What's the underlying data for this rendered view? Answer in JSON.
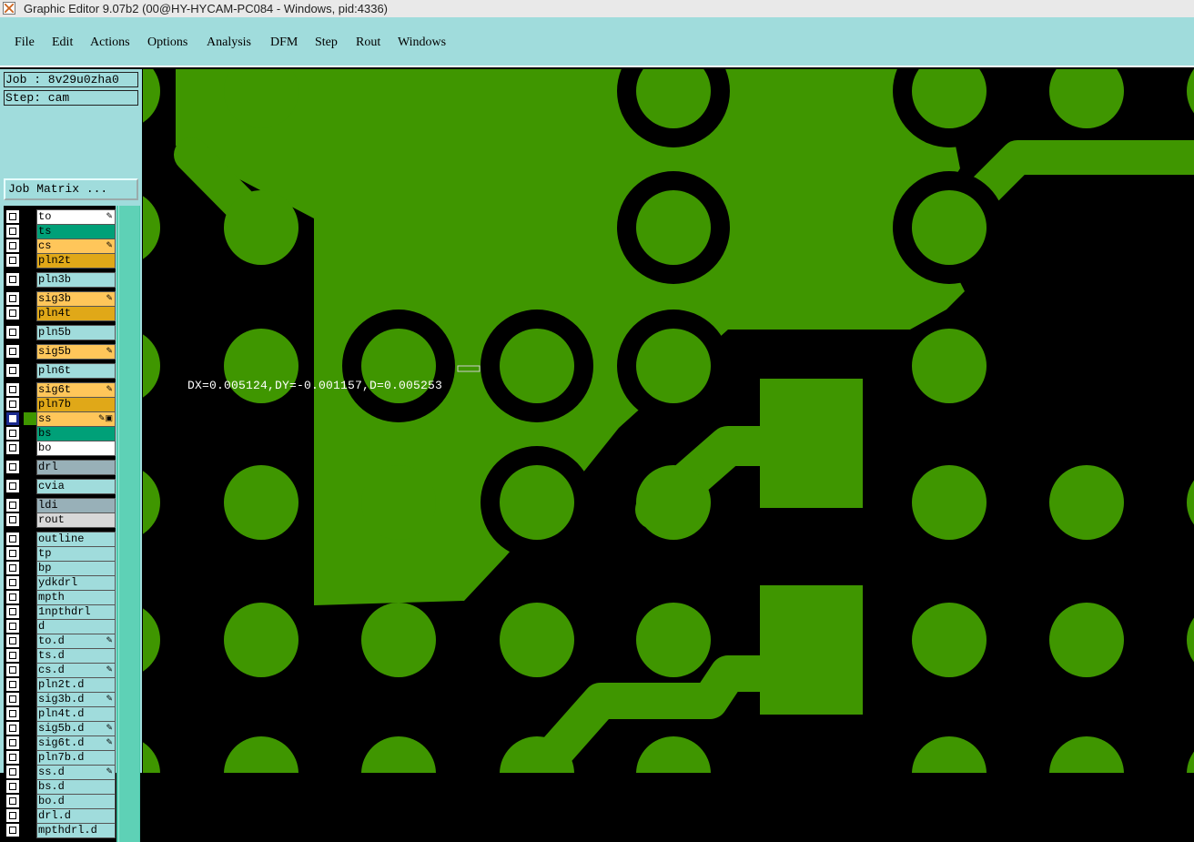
{
  "window": {
    "title": "Graphic Editor 9.07b2 (00@HY-HYCAM-PC084 - Windows, pid:4336)"
  },
  "menubar": {
    "items": [
      {
        "id": "file",
        "label": "File"
      },
      {
        "id": "edit",
        "label": "Edit"
      },
      {
        "id": "actions",
        "label": "Actions"
      },
      {
        "id": "options",
        "label": "Options"
      },
      {
        "id": "analysis",
        "label": "Analysis"
      },
      {
        "id": "dfm",
        "label": "DFM"
      },
      {
        "id": "step",
        "label": "Step"
      },
      {
        "id": "rout",
        "label": "Rout"
      },
      {
        "id": "windows",
        "label": "Windows"
      }
    ]
  },
  "panel": {
    "job": "Job : 8v29u0zha0",
    "step": "Step: cam",
    "job_matrix_label": "Job Matrix ..."
  },
  "layers": [
    {
      "name": "to",
      "color": "#ffffff",
      "mark": "✎",
      "active": false
    },
    {
      "name": "ts",
      "color": "#00a078",
      "mark": "",
      "active": false
    },
    {
      "name": "cs",
      "color": "#ffc65a",
      "mark": "✎",
      "active": false
    },
    {
      "name": "pln2t",
      "color": "#e0a818",
      "mark": "",
      "active": false
    },
    {
      "name": "pln3b",
      "color": "#a0dcdc",
      "mark": "",
      "active": false
    },
    {
      "name": "sig3b",
      "color": "#ffc65a",
      "mark": "✎",
      "active": false
    },
    {
      "name": "pln4t",
      "color": "#e0a818",
      "mark": "",
      "active": false
    },
    {
      "name": "pln5b",
      "color": "#a0dcdc",
      "mark": "",
      "active": false
    },
    {
      "name": "sig5b",
      "color": "#ffc65a",
      "mark": "✎",
      "active": false
    },
    {
      "name": "pln6t",
      "color": "#a0dcdc",
      "mark": "",
      "active": false
    },
    {
      "name": "sig6t",
      "color": "#ffc65a",
      "mark": "✎",
      "active": false
    },
    {
      "name": "pln7b",
      "color": "#e0a818",
      "mark": "",
      "active": false
    },
    {
      "name": "ss",
      "color": "#ffc65a",
      "mark": "✎▣",
      "active": true
    },
    {
      "name": "bs",
      "color": "#00a078",
      "mark": "",
      "active": false
    },
    {
      "name": "bo",
      "color": "#ffffff",
      "mark": "",
      "active": false
    },
    {
      "name": "drl",
      "color": "#98b0b8",
      "mark": "",
      "active": false
    },
    {
      "name": "cvia",
      "color": "#a0dcdc",
      "mark": "",
      "active": false
    },
    {
      "name": "ldi",
      "color": "#98b0b8",
      "mark": "",
      "active": false
    },
    {
      "name": "rout",
      "color": "#d8d8d8",
      "mark": "",
      "active": false
    },
    {
      "name": "outline",
      "color": "#a0dcdc",
      "mark": "",
      "active": false
    },
    {
      "name": "tp",
      "color": "#a0dcdc",
      "mark": "",
      "active": false
    },
    {
      "name": "bp",
      "color": "#a0dcdc",
      "mark": "",
      "active": false
    },
    {
      "name": "ydkdrl",
      "color": "#a0dcdc",
      "mark": "",
      "active": false
    },
    {
      "name": "mpth",
      "color": "#a0dcdc",
      "mark": "",
      "active": false
    },
    {
      "name": "1npthdrl",
      "color": "#a0dcdc",
      "mark": "",
      "active": false
    },
    {
      "name": "d",
      "color": "#a0dcdc",
      "mark": "",
      "active": false
    },
    {
      "name": "to.d",
      "color": "#a0dcdc",
      "mark": "✎",
      "active": false
    },
    {
      "name": "ts.d",
      "color": "#a0dcdc",
      "mark": "",
      "active": false
    },
    {
      "name": "cs.d",
      "color": "#a0dcdc",
      "mark": "✎",
      "active": false
    },
    {
      "name": "pln2t.d",
      "color": "#a0dcdc",
      "mark": "",
      "active": false
    },
    {
      "name": "sig3b.d",
      "color": "#a0dcdc",
      "mark": "✎",
      "active": false
    },
    {
      "name": "pln4t.d",
      "color": "#a0dcdc",
      "mark": "",
      "active": false
    },
    {
      "name": "sig5b.d",
      "color": "#a0dcdc",
      "mark": "✎",
      "active": false
    },
    {
      "name": "sig6t.d",
      "color": "#a0dcdc",
      "mark": "✎",
      "active": false
    },
    {
      "name": "pln7b.d",
      "color": "#a0dcdc",
      "mark": "",
      "active": false
    },
    {
      "name": "ss.d",
      "color": "#a0dcdc",
      "mark": "✎",
      "active": false
    },
    {
      "name": "bs.d",
      "color": "#a0dcdc",
      "mark": "",
      "active": false
    },
    {
      "name": "bo.d",
      "color": "#a0dcdc",
      "mark": "",
      "active": false
    },
    {
      "name": "drl.d",
      "color": "#a0dcdc",
      "mark": "",
      "active": false
    },
    {
      "name": "mpthdrl.d",
      "color": "#a0dcdc",
      "mark": "",
      "active": false
    }
  ],
  "canvas": {
    "copper_color": "#3f9600",
    "background_color": "#000000",
    "measure_readout": "DX=0.005124,DY=-0.001157,D=0.005253"
  }
}
